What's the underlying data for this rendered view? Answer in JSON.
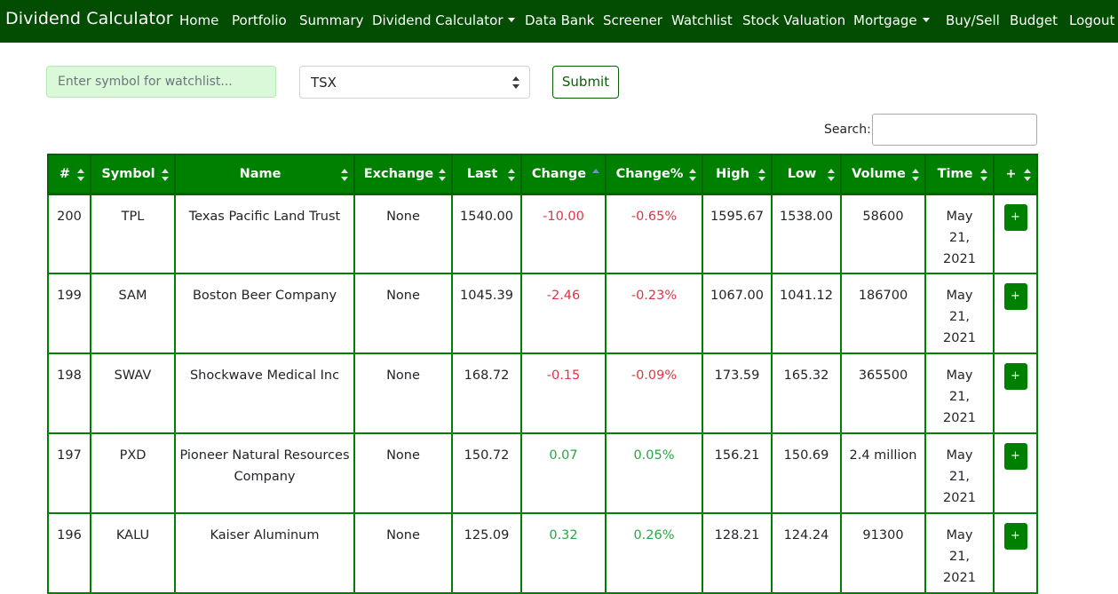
{
  "navbar": {
    "brand": "Dividend Calculator",
    "items": [
      {
        "label": "Home"
      },
      {
        "label": "Portfolio"
      },
      {
        "label": "Summary"
      },
      {
        "label": "Dividend Calculator"
      },
      {
        "label": "Data Bank"
      },
      {
        "label": "Screener"
      },
      {
        "label": "Watchlist"
      },
      {
        "label": "Stock Valuation"
      },
      {
        "label": "Mortgage"
      },
      {
        "label": "Buy/Sell"
      },
      {
        "label": "Budget"
      },
      {
        "label": "Logout"
      }
    ]
  },
  "form": {
    "symbol_placeholder": "Enter symbol for watchlist...",
    "exchange_selected": "TSX",
    "submit_label": "Submit"
  },
  "search": {
    "label": "Search:",
    "value": ""
  },
  "table": {
    "headers": [
      "#",
      "Symbol",
      "Name",
      "Exchange",
      "Last",
      "Change",
      "Change%",
      "High",
      "Low",
      "Volume",
      "Time",
      "+"
    ],
    "sorted_column": "Change",
    "add_label": "+",
    "rows": [
      {
        "num": "200",
        "symbol": "TPL",
        "name": "Texas Pacific Land Trust",
        "exchange": "None",
        "last": "1540.00",
        "change": "-10.00",
        "change_pct": "-0.65%",
        "high": "1595.67",
        "low": "1538.00",
        "volume": "58600",
        "time": [
          "May",
          "21,",
          "2021"
        ]
      },
      {
        "num": "199",
        "symbol": "SAM",
        "name": "Boston Beer Company",
        "exchange": "None",
        "last": "1045.39",
        "change": "-2.46",
        "change_pct": "-0.23%",
        "high": "1067.00",
        "low": "1041.12",
        "volume": "186700",
        "time": [
          "May",
          "21,",
          "2021"
        ]
      },
      {
        "num": "198",
        "symbol": "SWAV",
        "name": "Shockwave Medical Inc",
        "exchange": "None",
        "last": "168.72",
        "change": "-0.15",
        "change_pct": "-0.09%",
        "high": "173.59",
        "low": "165.32",
        "volume": "365500",
        "time": [
          "May",
          "21,",
          "2021"
        ]
      },
      {
        "num": "197",
        "symbol": "PXD",
        "name": "Pioneer Natural Resources Company",
        "exchange": "None",
        "last": "150.72",
        "change": "0.07",
        "change_pct": "0.05%",
        "high": "156.21",
        "low": "150.69",
        "volume": "2.4 million",
        "time": [
          "May",
          "21,",
          "2021"
        ]
      },
      {
        "num": "196",
        "symbol": "KALU",
        "name": "Kaiser Aluminum",
        "exchange": "None",
        "last": "125.09",
        "change": "0.32",
        "change_pct": "0.26%",
        "high": "128.21",
        "low": "124.24",
        "volume": "91300",
        "time": [
          "May",
          "21,",
          "2021"
        ]
      }
    ]
  },
  "colors": {
    "nav_bg": "#024d02",
    "header_bg": "#008000",
    "negative": "#dc3545",
    "positive": "#28a745",
    "input_bg": "#d9f9d9"
  }
}
